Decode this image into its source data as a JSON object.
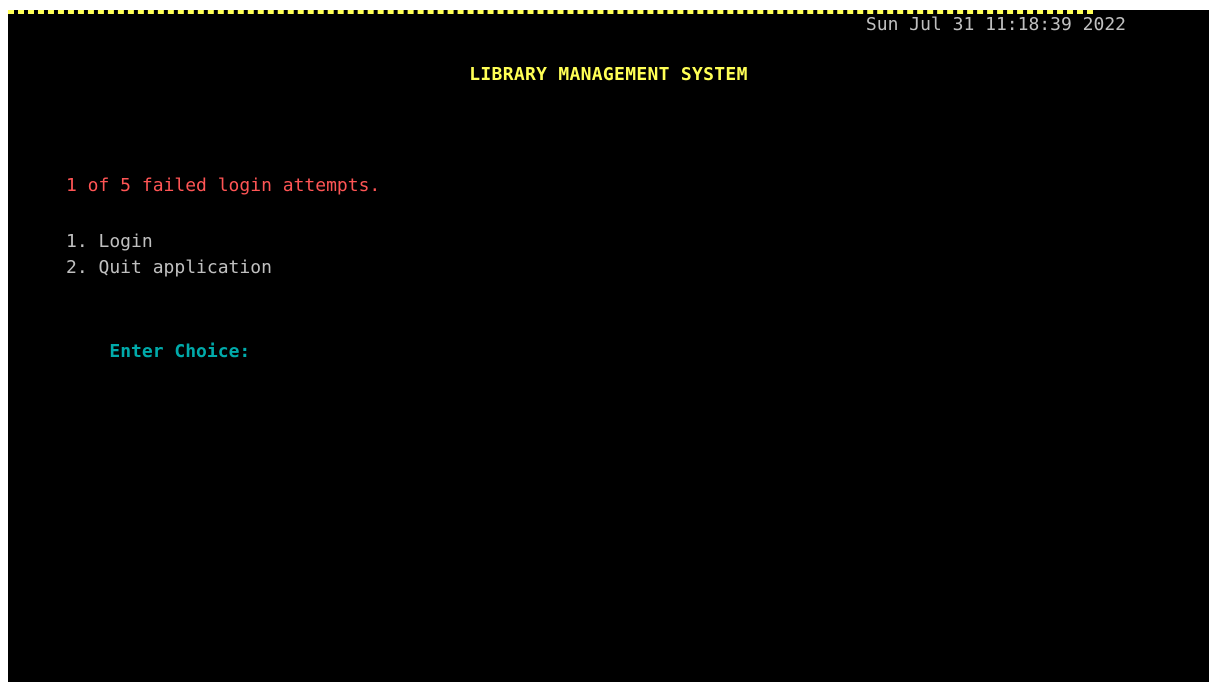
{
  "header": {
    "datetime": "Sun Jul 31 11:18:39 2022",
    "title": "LIBRARY MANAGEMENT SYSTEM"
  },
  "status": {
    "error_message": "1 of 5 failed login attempts."
  },
  "menu": {
    "items": [
      {
        "label": "1. Login"
      },
      {
        "label": "2. Quit application"
      }
    ]
  },
  "prompt": {
    "label": "Enter Choice:"
  },
  "colors": {
    "background": "#000000",
    "text": "#c0c0c0",
    "title": "#ffff55",
    "error": "#ff5555",
    "prompt": "#00aaaa"
  }
}
